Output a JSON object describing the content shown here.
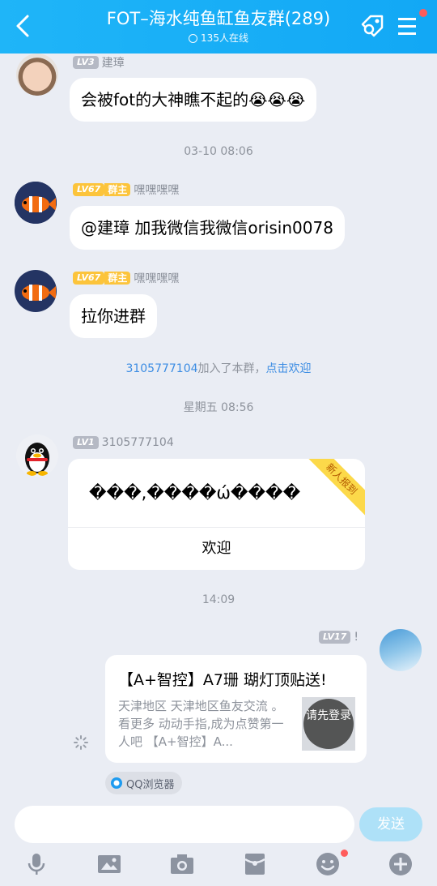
{
  "header": {
    "title": "FOT–海水纯鱼缸鱼友群(289)",
    "online": "135人在线"
  },
  "messages": {
    "m1": {
      "level": "LV3",
      "name": "建璋",
      "text": "会被fot的大神瞧不起的😭😭😭"
    },
    "time1": "03-10 08:06",
    "m2": {
      "level": "LV67",
      "role": "群主",
      "name": "嘿嘿嘿嘿",
      "text": "@建璋 加我微信我微信orisin0078"
    },
    "m3": {
      "level": "LV67",
      "role": "群主",
      "name": "嘿嘿嘿嘿",
      "text": "拉你进群"
    },
    "system": {
      "user": "3105777104",
      "action": "加入了本群，",
      "link": "点击欢迎"
    },
    "time2": "星期五 08:56",
    "m4": {
      "level": "LV1",
      "name": "3105777104",
      "text": "���,����ώ����",
      "ribbon": "新人报到",
      "welcome": "欢迎"
    },
    "time3": "14:09",
    "m5": {
      "level": "LV17",
      "name": "!",
      "title": "【A+智控】A7珊 瑚灯顶贴送!",
      "desc": "天津地区 天津地区鱼友交流 。 看更多 动动手指,成为点赞第一人吧 【A+智控】A...",
      "login": "请先登录",
      "source": "QQ浏览器"
    }
  },
  "input": {
    "placeholder": "",
    "send_label": "发送"
  },
  "colors": {
    "header": "#12a8f5",
    "accent_link": "#3b8ce3",
    "badge_gold": "#fcc43b"
  }
}
